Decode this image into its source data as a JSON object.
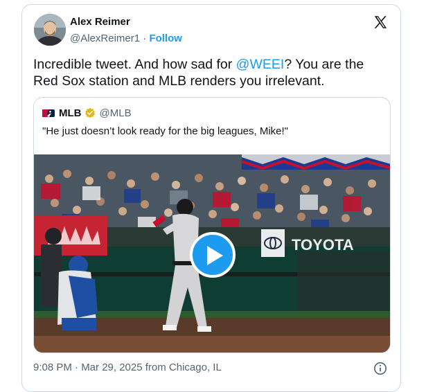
{
  "author": {
    "name": "Alex Reimer",
    "handle": "@AlexReimer1",
    "separator": "·",
    "follow_label": "Follow"
  },
  "tweet": {
    "text_before": "Incredible tweet. And how sad for ",
    "mention": "@WEEI",
    "text_after": "? You are the Red Sox station and MLB renders you irrelevant."
  },
  "quoted": {
    "name": "MLB",
    "handle": "@MLB",
    "text": "\"He just doesn’t look ready for the big leagues, Mike!\"",
    "media": {
      "signage": "TOYOTA",
      "play_icon": "play-icon"
    }
  },
  "footer": {
    "timestamp": "9:08 PM · Mar 29, 2025 from Chicago, IL"
  },
  "icons": [
    "x-logo-icon",
    "verified-badge-icon",
    "mlb-logo-icon",
    "play-icon",
    "info-icon"
  ],
  "colors": {
    "accent": "#1d9bf0",
    "text": "#0f1419",
    "muted": "#536471",
    "border": "#cfd9de",
    "verified_gold": "#e2b719"
  }
}
